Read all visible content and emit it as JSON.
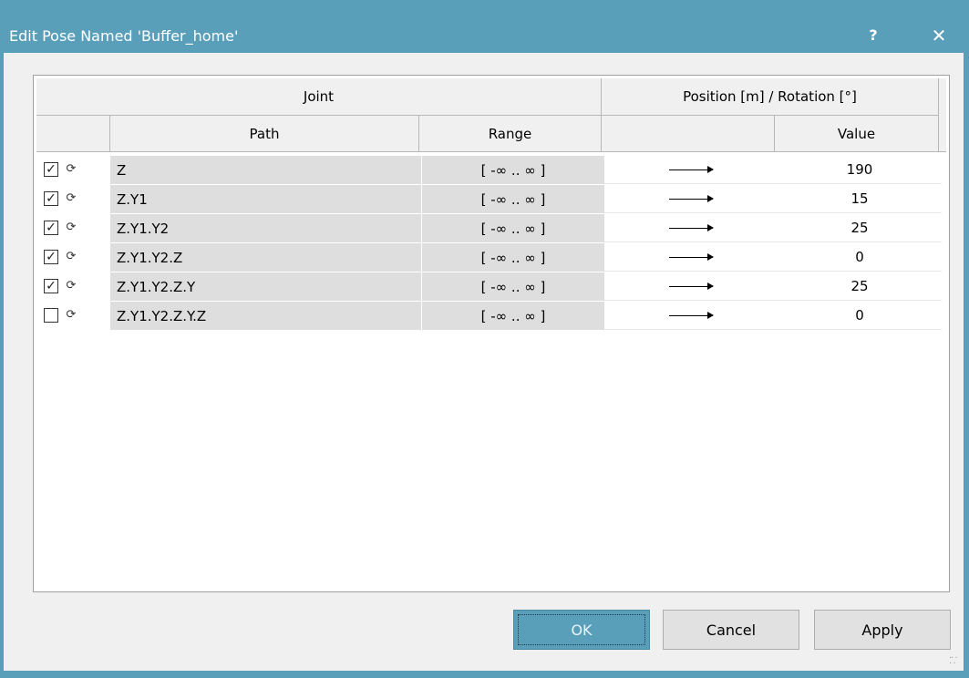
{
  "window": {
    "title": "Edit Pose Named 'Buffer_home'",
    "help_label": "?",
    "close_label": "✕",
    "accent_color": "#5a9fba"
  },
  "table": {
    "group_headers": {
      "joint": "Joint",
      "position_rotation": "Position [m] / Rotation [°]"
    },
    "columns": {
      "path": "Path",
      "range": "Range",
      "value": "Value"
    },
    "rows": [
      {
        "checked": true,
        "check_mark": "✓",
        "path": "Z",
        "range": "[ -∞ .. ∞ ]",
        "value": "190"
      },
      {
        "checked": true,
        "check_mark": "✓",
        "path": "Z.Y1",
        "range": "[ -∞ .. ∞ ]",
        "value": "15"
      },
      {
        "checked": true,
        "check_mark": "✓",
        "path": "Z.Y1.Y2",
        "range": "[ -∞ .. ∞ ]",
        "value": "25"
      },
      {
        "checked": true,
        "check_mark": "✓",
        "path": "Z.Y1.Y2.Z",
        "range": "[ -∞ .. ∞ ]",
        "value": "0"
      },
      {
        "checked": true,
        "check_mark": "✓",
        "path": "Z.Y1.Y2.Z.Y",
        "range": "[ -∞ .. ∞ ]",
        "value": "25"
      },
      {
        "checked": false,
        "check_mark": "",
        "path": "Z.Y1.Y2.Z.Y.Z",
        "range": "[ -∞ .. ∞ ]",
        "value": "0"
      }
    ]
  },
  "buttons": {
    "ok": "OK",
    "cancel": "Cancel",
    "apply": "Apply"
  }
}
